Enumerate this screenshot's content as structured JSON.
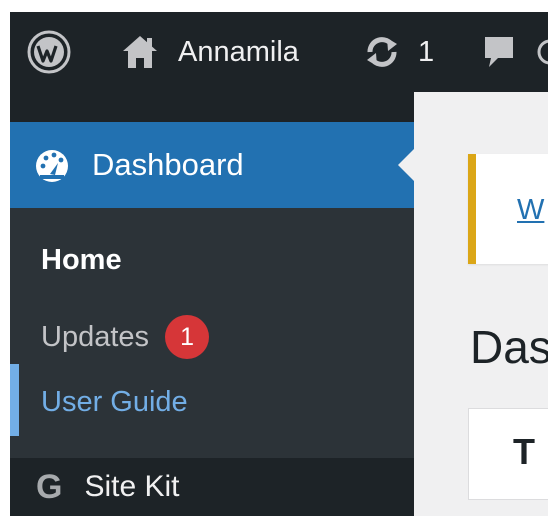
{
  "admin_bar": {
    "site_name": "Annamila",
    "updates_count": "1",
    "icons": [
      "wordpress-logo-icon",
      "home-icon",
      "updates-icon",
      "comments-icon"
    ]
  },
  "sidebar": {
    "dashboard_label": "Dashboard",
    "submenu": {
      "home": "Home",
      "updates": "Updates",
      "updates_badge": "1",
      "user_guide": "User Guide"
    },
    "sitekit_label": "Site Kit",
    "sitekit_icon_glyph": "G"
  },
  "content": {
    "notice_link": "W",
    "page_title": "Das",
    "widget_title": "T"
  },
  "colors": {
    "admin_bar_bg": "#1d2327",
    "active_menu_bg": "#2271b1",
    "submenu_bg": "#2c3338",
    "current_item": "#72aee6",
    "badge": "#d63638",
    "notice_border": "#dba617"
  }
}
